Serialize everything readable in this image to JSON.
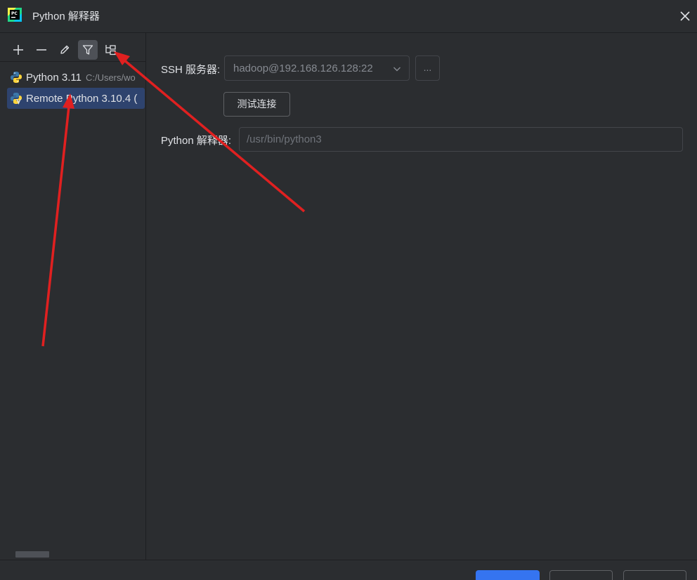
{
  "window": {
    "title": "Python 解释器",
    "app_icon": "pycharm-icon",
    "close_icon": "close-icon"
  },
  "sidebar": {
    "toolbar": [
      {
        "icon": "plus-icon"
      },
      {
        "icon": "minus-icon"
      },
      {
        "icon": "pencil-icon"
      },
      {
        "icon": "filter-icon",
        "active": true
      },
      {
        "icon": "tree-icon"
      }
    ],
    "interpreters": [
      {
        "name": "Python 3.11",
        "path": "C:/Users/wo",
        "icon": "python-icon",
        "selected": false
      },
      {
        "name": "Remote Python 3.10.4 (",
        "path": "",
        "icon": "python-remote-icon",
        "selected": true
      }
    ]
  },
  "main": {
    "ssh_label": "SSH 服务器:",
    "ssh_value": "hadoop@192.168.126.128:22",
    "ellipsis_label": "...",
    "test_button": "测试连接",
    "interpreter_label": "Python 解释器:",
    "interpreter_path": "/usr/bin/python3"
  },
  "annotations": {
    "arrow_color": "#e02020"
  },
  "colors": {
    "background": "#2b2d30",
    "selection": "#2e436e",
    "primary_button": "#3574f0"
  }
}
